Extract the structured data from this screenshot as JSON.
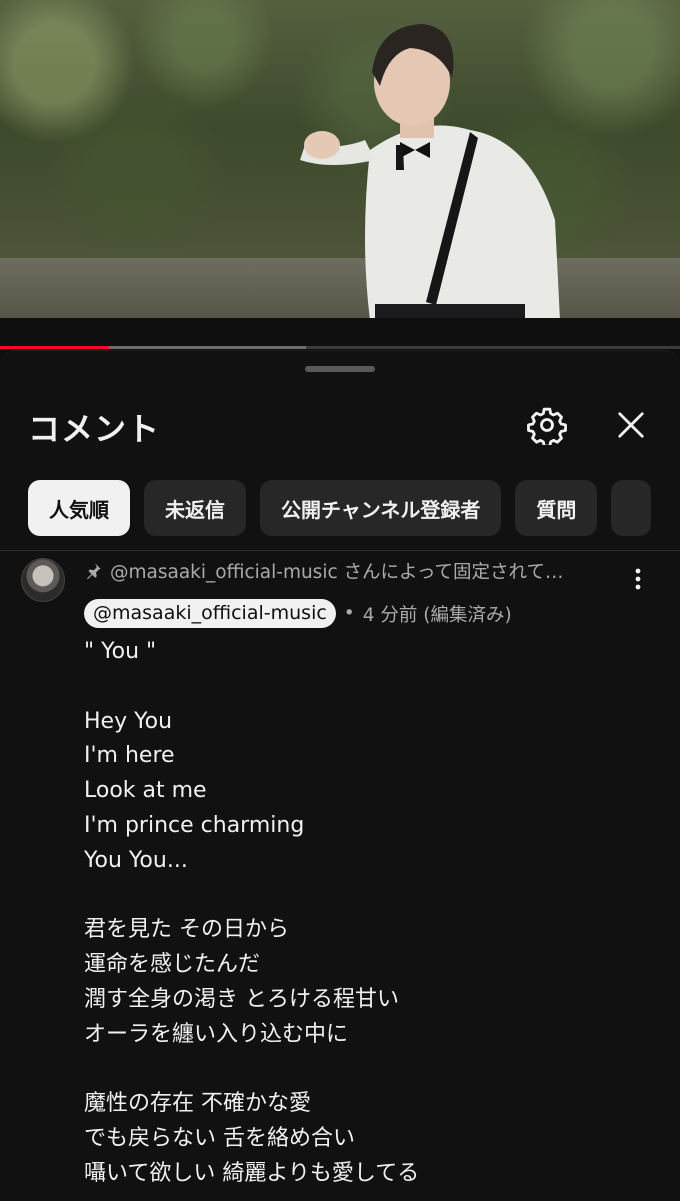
{
  "video": {
    "progress_played": 0.16,
    "progress_buffered": 0.45
  },
  "comments_panel": {
    "title": "コメント",
    "settings_icon": "gear-icon",
    "close_icon": "close-icon"
  },
  "filter_chips": [
    {
      "label": "人気順",
      "selected": true
    },
    {
      "label": "未返信",
      "selected": false
    },
    {
      "label": "公開チャンネル登録者",
      "selected": false
    },
    {
      "label": "質問",
      "selected": false
    }
  ],
  "pinned_comment": {
    "pinned_text": "@masaaki_official-music さんによって固定されて…",
    "author": "@masaaki_official-music",
    "separator": "•",
    "time": "4 分前 (編集済み)",
    "lines": [
      "\" You \"",
      "",
      "Hey You",
      "I'm here",
      "Look at me",
      "I'm prince charming",
      "You You...",
      "",
      "君を見た その日から",
      "運命を感じたんだ",
      "潤す全身の渇き とろける程甘い",
      "オーラを纏い入り込む中に",
      "",
      "魔性の存在 不確かな愛",
      "でも戻らない 舌を絡め合い",
      "囁いて欲しい 綺麗よりも愛してる"
    ]
  },
  "colors": {
    "background": "#0f0f0f",
    "progress_played": "#ff0033",
    "chip_active_bg": "#f1f1f1",
    "chip_bg": "#272727"
  }
}
